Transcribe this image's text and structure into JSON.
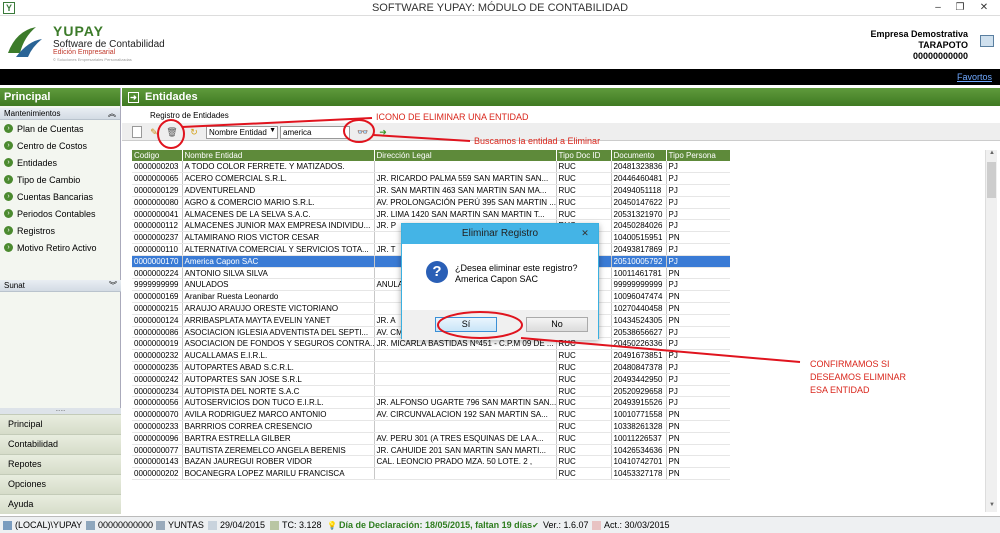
{
  "window": {
    "title": "SOFTWARE YUPAY: MÓDULO DE CONTABILIDAD",
    "app_icon_letter": "Y"
  },
  "header": {
    "brand": "YUPAY",
    "subtitle": "Software de Contabilidad",
    "edition": "Edición Empresarial",
    "tagline": "© Soluciones Empresariales Personalizadas",
    "company_name": "Empresa Demostrativa",
    "company_city": "TARAPOTO",
    "company_ruc": "00000000000"
  },
  "favbar": {
    "favorites_label": "Favortos"
  },
  "sidebar": {
    "title": "Principal",
    "mantenimientos_label": "Mantenimientos",
    "items": [
      {
        "label": "Plan de Cuentas"
      },
      {
        "label": "Centro de Costos"
      },
      {
        "label": "Entidades"
      },
      {
        "label": "Tipo de Cambio"
      },
      {
        "label": "Cuentas Bancarias"
      },
      {
        "label": "Periodos Contables"
      },
      {
        "label": "Registros"
      },
      {
        "label": "Motivo Retiro Activo"
      }
    ],
    "sunat_label": "Sunat",
    "dots": "......",
    "bottom_buttons": [
      "Principal",
      "Contabilidad",
      "Repotes",
      "Opciones",
      "Ayuda"
    ]
  },
  "main": {
    "title": "Entidades",
    "registro_label": "Registro de Entidades",
    "search_by": "Nombre Entidad",
    "search_value": "america"
  },
  "table": {
    "columns": [
      "Codigo",
      "Nombre Entidad",
      "Dirección Legal",
      "Tipo Doc ID",
      "Documento",
      "Tipo Persona"
    ],
    "rows": [
      [
        "0000000203",
        "A TODO COLOR FERRETE. Y MATIZADOS.",
        "",
        "RUC",
        "20481323836",
        "PJ"
      ],
      [
        "0000000065",
        "ACERO COMERCIAL S.R.L.",
        "JR.  RICARDO PALMA 559  SAN MARTIN SAN...",
        "RUC",
        "20446460481",
        "PJ"
      ],
      [
        "0000000129",
        "ADVENTURELAND",
        "JR.  SAN MARTIN 463  SAN MARTIN SAN MA...",
        "RUC",
        "20494051118",
        "PJ"
      ],
      [
        "0000000080",
        "AGRO & COMERCIO MARIO S.R.L.",
        "AV.  PROLONGACIÓN PERÚ 395  SAN MARTIN ...",
        "RUC",
        "20450147622",
        "PJ"
      ],
      [
        "0000000041",
        "ALMACENES DE LA SELVA S.A.C.",
        "JR.  LIMA 1420 SAN MARTIN SAN MARTIN T...",
        "RUC",
        "20531321970",
        "PJ"
      ],
      [
        "0000000112",
        "ALMACENES JUNIOR MAX EMPRESA INDIVIDU...",
        "JR.  P",
        "RUC",
        "20450284026",
        "PJ"
      ],
      [
        "0000000237",
        "ALTAMIRANO RIOS VICTOR CESAR",
        "",
        "RUC",
        "10400515951",
        "PN"
      ],
      [
        "0000000110",
        "ALTERNATIVA COMERCIAL Y SERVICIOS TOTA...",
        "JR.  T",
        "RUC",
        "20493817869",
        "PJ"
      ],
      [
        "0000000170",
        "America Capon SAC",
        "",
        "RUC",
        "20510005792",
        "PJ"
      ],
      [
        "0000000224",
        "ANTONIO SILVA SILVA",
        "",
        "RUC",
        "10011461781",
        "PN"
      ],
      [
        "9999999999",
        "ANULADOS",
        "ANULA",
        "RUC",
        "99999999999",
        "PJ"
      ],
      [
        "0000000169",
        "Aranibar Ruesta Leonardo",
        "",
        "RUC",
        "10096047474",
        "PN"
      ],
      [
        "0000000215",
        "ARAUJO ARAUJO ORESTE VICTORIANO",
        "",
        "RUC",
        "10270440458",
        "PN"
      ],
      [
        "0000000124",
        "ARRIBASPLATA MAYTA EVELIN YANET",
        "JR.  A",
        "RUC",
        "10434524305",
        "PN"
      ],
      [
        "0000000086",
        "ASOCIACION  IGLESIA ADVENTISTA DEL SEPTI...",
        "AV.  CMDTE  ESPINAR  650  LIMA LIMA MIRA...",
        "RUC",
        "20538656627",
        "PJ"
      ],
      [
        "0000000019",
        "ASOCIACION DE FONDOS Y SEGUROS CONTRA...",
        "JR. MICARLA BASTIDAS Nº451 - C.P.M 09 DE ...",
        "RUC",
        "20450226336",
        "PJ"
      ],
      [
        "0000000232",
        "AUCALLAMAS E.I.R.L.",
        "",
        "RUC",
        "20491673851",
        "PJ"
      ],
      [
        "0000000235",
        "AUTOPARTES ABAD S.C.R.L.",
        "",
        "RUC",
        "20480847378",
        "PJ"
      ],
      [
        "0000000242",
        "AUTOPARTES SAN JOSE S.R.L",
        "",
        "RUC",
        "20493442950",
        "PJ"
      ],
      [
        "0000000234",
        "AUTOPISTA DEL NORTE S.A.C",
        "",
        "RUC",
        "20520929658",
        "PJ"
      ],
      [
        "0000000056",
        "AUTOSERVICIOS DON TUCO  E.I.R.L.",
        "JR.  ALFONSO UGARTE 796  SAN MARTIN SAN...",
        "RUC",
        "20493915526",
        "PJ"
      ],
      [
        "0000000070",
        "AVILA RODRIGUEZ MARCO ANTONIO",
        "AV.  CIRCUNVALACION 192  SAN MARTIN SA...",
        "RUC",
        "10010771558",
        "PN"
      ],
      [
        "0000000233",
        "BARRRIOS CORREA CRESENCIO",
        "",
        "RUC",
        "10338261328",
        "PN"
      ],
      [
        "0000000096",
        "BARTRA ESTRELLA GILBER",
        "AV.  PERU 301  (A TRES ESQUINAS DE LA A...",
        "RUC",
        "10011226537",
        "PN"
      ],
      [
        "0000000077",
        "BAUTISTA ZEREMELCO ANGELA BERENIS",
        "JR.  CAHUIDE 201  SAN MARTIN SAN MARTI...",
        "RUC",
        "10426534636",
        "PN"
      ],
      [
        "0000000143",
        "BAZAN JAUREGUI ROBER VIDOR",
        "CAL. LEONCIO PRADO MZA. 50  LOTE. 2   ,",
        "RUC",
        "10410742701",
        "PN"
      ],
      [
        "0000000202",
        "BOCANEGRA LOPEZ MARILU FRANCISCA",
        "",
        "RUC",
        "10453327178",
        "PN"
      ]
    ],
    "selected_index": 8
  },
  "dialog": {
    "title": "Eliminar Registro",
    "close_glyph": "✕",
    "question": "¿Desea eliminar este registro?",
    "entity": "America Capon SAC",
    "yes_label": "Sí",
    "no_label": "No"
  },
  "annotations": {
    "delete_icon": "ICONO DE ELIMINAR UNA ENTIDAD",
    "search": "Buscamos la entidad a Eliminar",
    "confirm_1": "CONFIRMAMOS SI",
    "confirm_2": "DESEAMOS ELIMINAR",
    "confirm_3": "ESA ENTIDAD"
  },
  "statusbar": {
    "db": "(LOCAL)\\YUPAY",
    "ruc": "00000000000",
    "user": "YUNTAS",
    "date": "29/04/2015",
    "tc": "TC: 3.128",
    "declaracion": "Día de Declaración: 18/05/2015, faltan 19 días",
    "version": "Ver.: 1.6.07",
    "act": "Act.: 30/03/2015"
  },
  "colors": {
    "brand_green": "#3f7a22",
    "selection": "#3a7bd5",
    "annotation_red": "#d9261c",
    "dialog_accent": "#44b4e6"
  }
}
